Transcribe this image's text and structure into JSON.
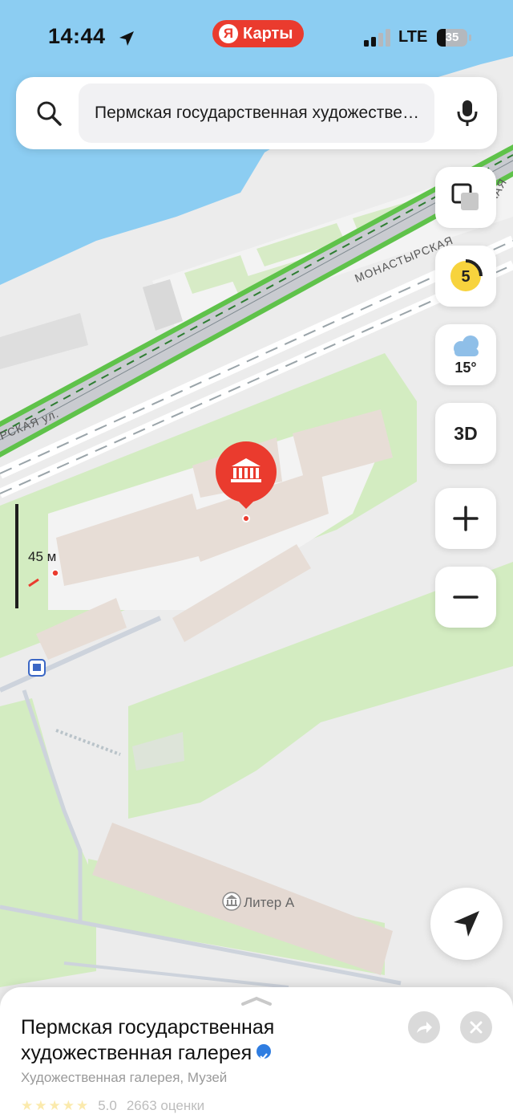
{
  "status_bar": {
    "time": "14:44",
    "app_badge": "Карты",
    "app_badge_logo": "Я",
    "network": "LTE",
    "battery": "35",
    "battery_level": 0.35
  },
  "search": {
    "query": "Пермская государственная художественная галерея"
  },
  "map": {
    "street_label": "МОНАСТЫРСКАЯ",
    "street_label_short": "РСКАЯ ул.",
    "street_label_right": "СКАЯ",
    "building_label": "Литер А",
    "scale_label": "45 м"
  },
  "controls": {
    "traffic_level": "5",
    "weather_temp": "15°",
    "view_3d": "3D"
  },
  "place_card": {
    "title": "Пермская государственная художественная галерея",
    "category": "Художественная галерея, Музей",
    "rating": "5.0",
    "reviews": "2663 оценки"
  },
  "icons": [
    "location-arrow-icon",
    "signal-icon",
    "battery-icon",
    "search-icon",
    "microphone-icon",
    "layers-icon",
    "weather-cloud-icon",
    "plus-icon",
    "minus-icon",
    "navigation-arrow-icon",
    "museum-icon",
    "share-icon",
    "close-icon",
    "verified-icon",
    "star-icon",
    "bus-stop-icon"
  ],
  "colors": {
    "accent": "#ea3b2e",
    "water": "#8ccdf2",
    "park": "#d3ecc1",
    "building": "#e7ddd6",
    "road_green": "#5fc24a"
  }
}
